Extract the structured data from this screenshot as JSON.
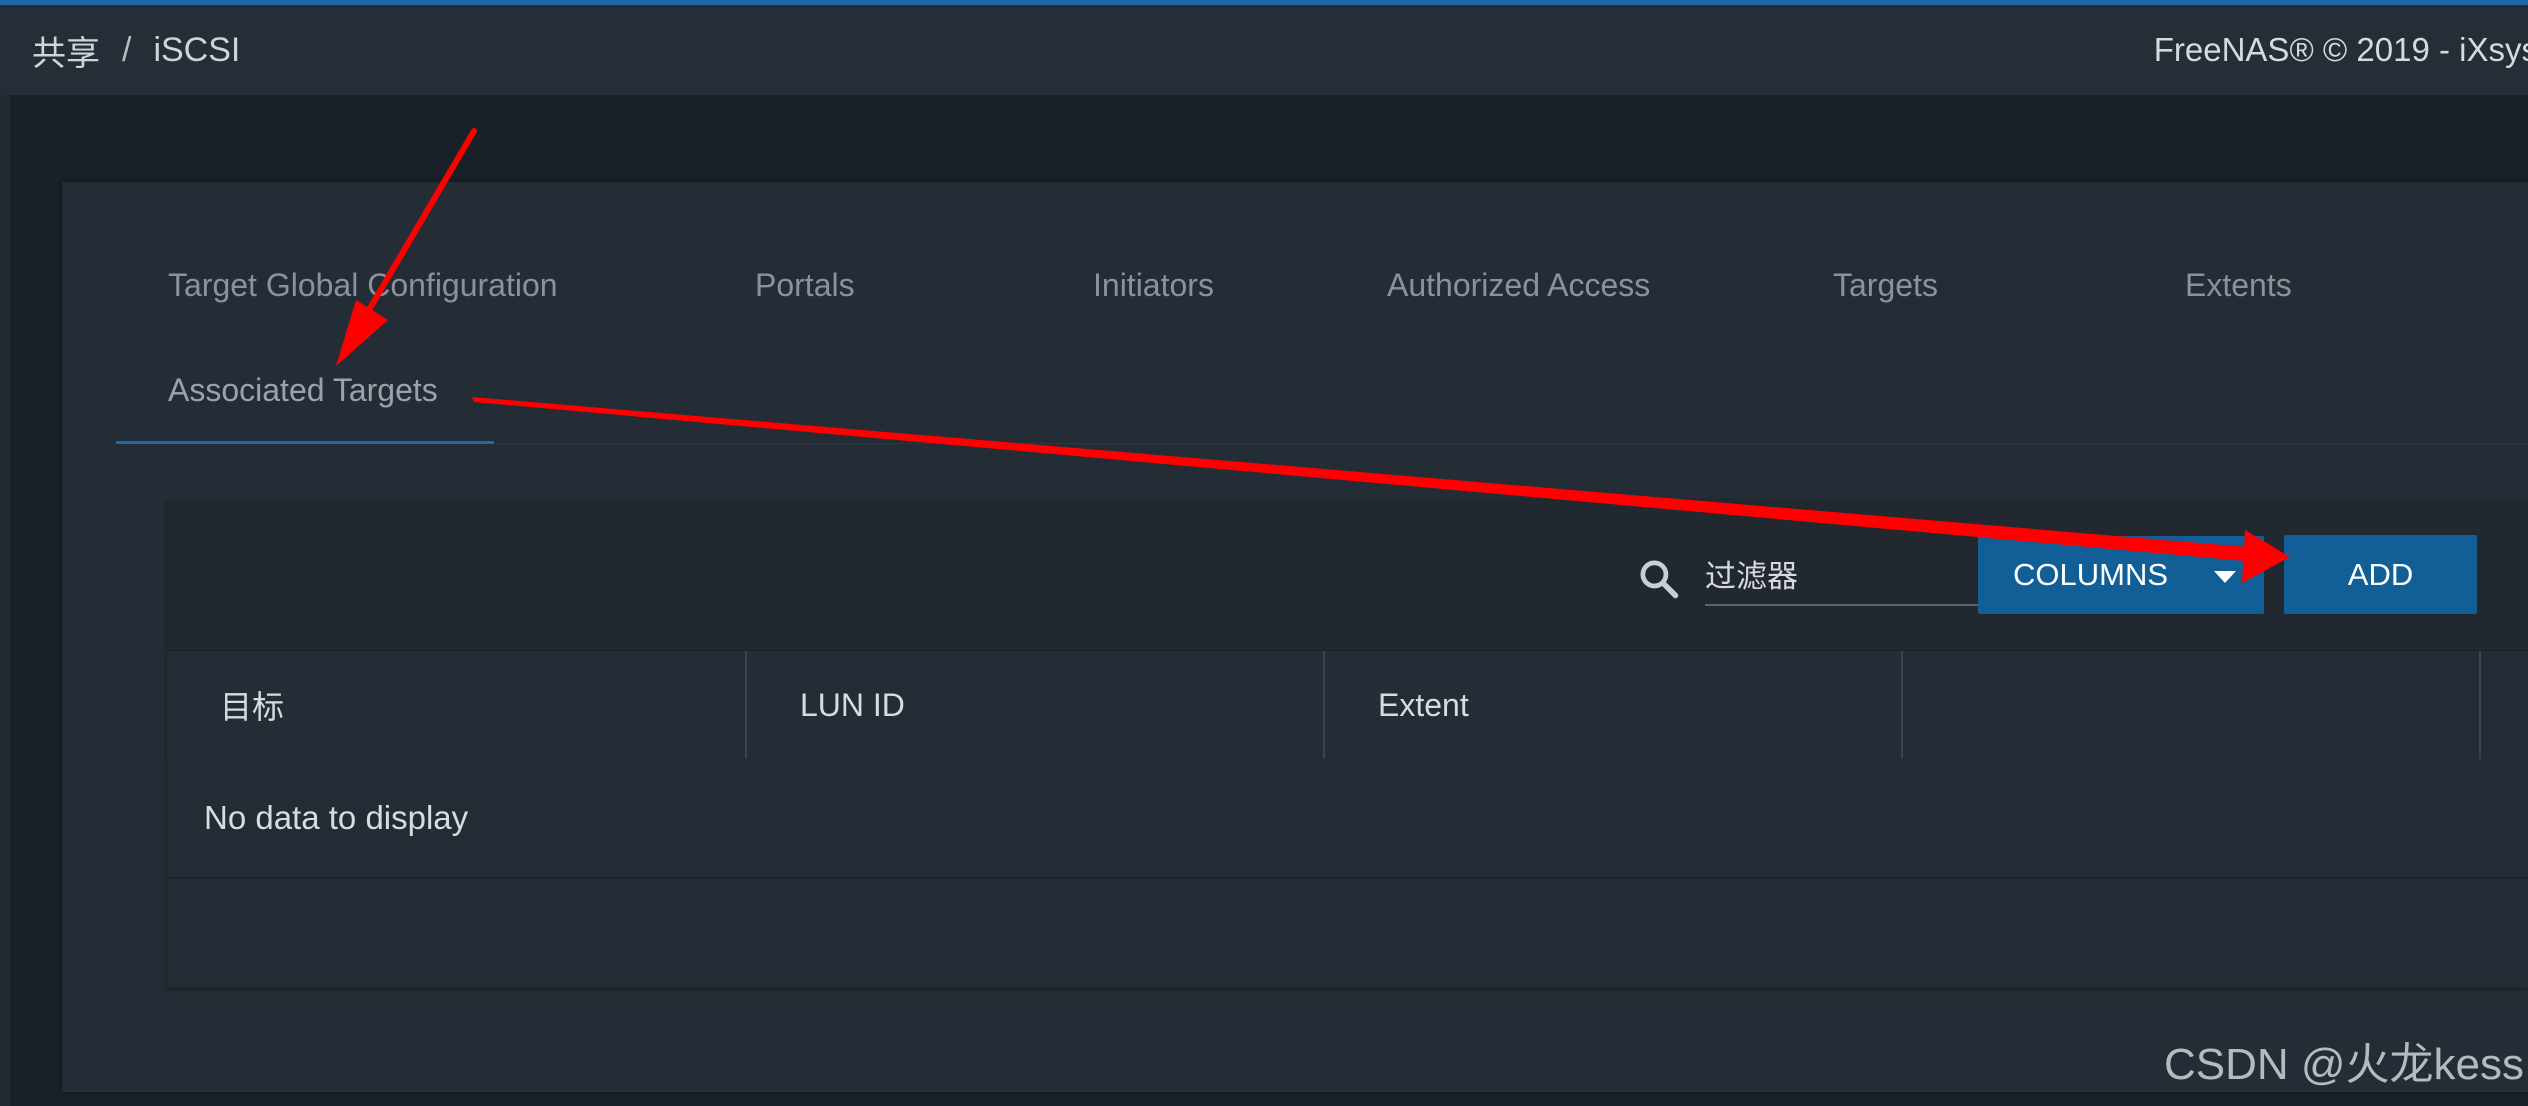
{
  "header": {
    "breadcrumb_root": "共享",
    "breadcrumb_separator": "/",
    "breadcrumb_current": "iSCSI",
    "copyright": "FreeNAS® © 2019 - iXsys"
  },
  "tabs": [
    {
      "label": "Target Global Configuration"
    },
    {
      "label": "Portals"
    },
    {
      "label": "Initiators"
    },
    {
      "label": "Authorized Access"
    },
    {
      "label": "Targets"
    },
    {
      "label": "Extents"
    },
    {
      "label": "Associated Targets",
      "active": true
    }
  ],
  "toolbar": {
    "search_icon": "search-icon",
    "filter_placeholder": "过滤器",
    "columns_label": "COLUMNS",
    "add_label": "ADD"
  },
  "table": {
    "columns": [
      "目标",
      "LUN ID",
      "Extent",
      ""
    ],
    "empty_message": "No data to display"
  },
  "colors": {
    "accent": "#125e96",
    "background": "#1a2028",
    "card": "#242c35",
    "annotation_arrow": "#ff0000"
  },
  "watermark": "CSDN @火龙kess"
}
